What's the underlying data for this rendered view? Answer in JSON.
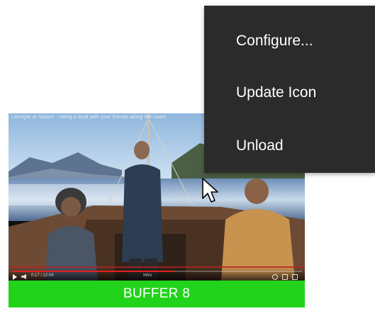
{
  "video_tile": {
    "video_title": "Lifestyle of Sailors - riding a boat with your friends along the coast",
    "playback_time": "0:17 / 12:04",
    "chapter_label": "Intro",
    "progress_fraction": 0.56,
    "label": "BUFFER 8",
    "label_color": "#22d31b"
  },
  "context_menu": {
    "items": [
      {
        "label": "Configure..."
      },
      {
        "label": "Update Icon"
      },
      {
        "label": "Unload"
      }
    ],
    "background": "#2b2b2b"
  },
  "cursor": {
    "icon": "arrow-pointer-icon"
  }
}
